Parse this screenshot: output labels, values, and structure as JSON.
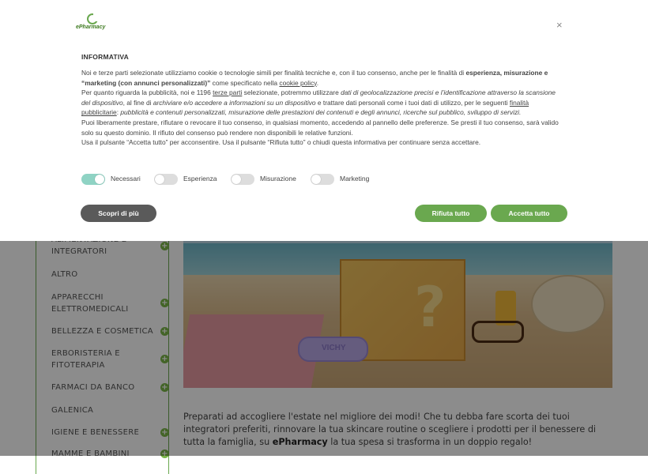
{
  "brand": {
    "logo_text": "ePharmacy",
    "accent": "#6aa84f"
  },
  "banner": {
    "close_label": "×",
    "heading": "INFORMATIVA",
    "p1_a": "Noi e terze parti selezionate utilizziamo cookie o tecnologie simili per finalità tecniche e, con il tuo consenso, anche per le finalità di ",
    "p1_b": "esperienza, misurazione e “marketing (con annunci personalizzati)”",
    "p1_c": " come specificato nella ",
    "p1_link": "cookie policy",
    "p1_d": ".",
    "p2_a": "Per quanto riguarda la pubblicità, noi e 1196 ",
    "p2_link1": "terze parti",
    "p2_b": " selezionate, potremmo utilizzare ",
    "p2_i1": "dati di geolocalizzazione precisi e l’identificazione attraverso la scansione del dispositivo",
    "p2_c": ", al fine di ",
    "p2_i2": "archiviare e/o accedere a informazioni su un dispositivo",
    "p2_d": " e trattare dati personali come i tuoi dati di utilizzo, per le seguenti ",
    "p2_link2": "finalità pubblicitarie",
    "p2_e": ": ",
    "p2_i3": "pubblicità e contenuti personalizzati, misurazione delle prestazioni dei contenuti e degli annunci, ricerche sul pubblico, sviluppo di servizi.",
    "p3": "Puoi liberamente prestare, rifiutare o revocare il tuo consenso, in qualsiasi momento, accedendo al pannello delle preferenze. Se presti il tuo consenso, sarà valido solo su questo dominio. Il rifiuto del consenso può rendere non disponibili le relative funzioni.",
    "p4": "Usa il pulsante “Accetta tutto” per acconsentire. Usa il pulsante “Rifiuta tutto” o chiudi questa informativa per continuare senza accettare.",
    "toggles": [
      {
        "label": "Necessari",
        "on": true
      },
      {
        "label": "Esperienza",
        "on": false
      },
      {
        "label": "Misurazione",
        "on": false
      },
      {
        "label": "Marketing",
        "on": false
      }
    ],
    "btn_more": "Scopri di più",
    "btn_reject": "Rifiuta tutto",
    "btn_accept": "Accetta tutto"
  },
  "sidebar": {
    "items": [
      {
        "label": "ALIMENTAZIONE E INTEGRATORI",
        "plus": "+"
      },
      {
        "label": "ALTRO"
      },
      {
        "label": "APPARECCHI ELETTROMEDICALI",
        "plus": "+"
      },
      {
        "label": "BELLEZZA E COSMETICA",
        "plus": "+"
      },
      {
        "label": "ERBORISTERIA E FITOTERAPIA",
        "plus": "+"
      },
      {
        "label": "FARMACI DA BANCO",
        "plus": "+"
      },
      {
        "label": "GALENICA"
      },
      {
        "label": "IGIENE E BENESSERE",
        "plus": "+"
      },
      {
        "label": "MAMME E BAMBINI",
        "plus": "+"
      }
    ]
  },
  "hero": {
    "bracelet_text": "VICHY"
  },
  "intro": {
    "a": "Preparati ad accogliere l'estate nel migliore dei modi! Che tu debba fare scorta dei tuoi integratori preferiti, rinnovare la tua skincare routine o scegliere i prodotti per il benessere di tutta la famiglia, su ",
    "brand": "ePharmacy",
    "b": " la tua spesa si trasforma in un doppio regalo!"
  }
}
